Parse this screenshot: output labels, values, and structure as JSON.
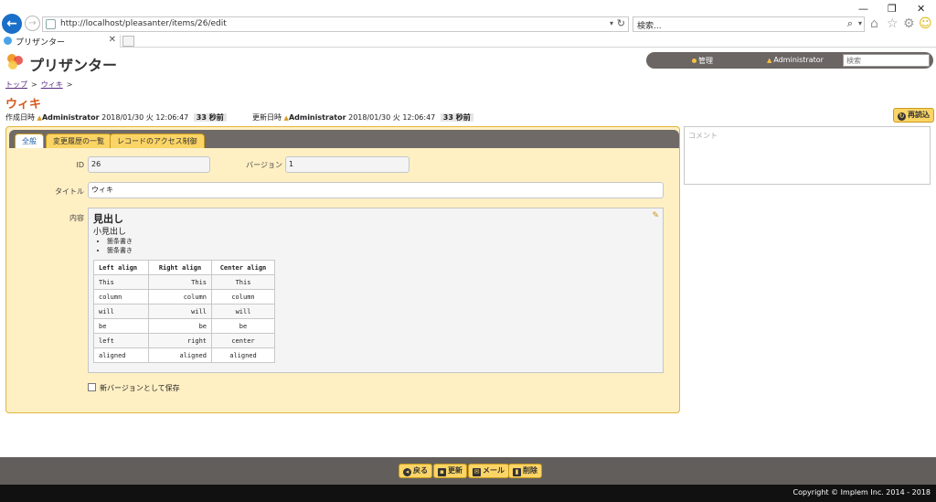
{
  "browser": {
    "url": "http://localhost/pleasanter/items/26/edit",
    "search_placeholder": "検索...",
    "tab_title": "プリザンター"
  },
  "app": {
    "logo_text": "プリザンター",
    "header": {
      "admin_link": "管理",
      "user": "Administrator",
      "search_placeholder": "検索"
    }
  },
  "breadcrumb": [
    "トップ",
    "ウィキ"
  ],
  "page_title": "ウィキ",
  "meta": {
    "created_label": "作成日時",
    "created_user": "Administrator",
    "created_time": "2018/01/30 火 12:06:47",
    "created_ago": "33 秒前",
    "updated_label": "更新日時",
    "updated_user": "Administrator",
    "updated_time": "2018/01/30 火 12:06:47",
    "updated_ago": "33 秒前"
  },
  "reload_button": "再読込",
  "comment_placeholder": "コメント",
  "tabs": [
    "全般",
    "変更履歴の一覧",
    "レコードのアクセス制御"
  ],
  "form": {
    "id_label": "ID",
    "id_value": "26",
    "version_label": "バージョン",
    "version_value": "1",
    "title_label": "タイトル",
    "title_value": "ウィキ",
    "content_label": "内容",
    "save_new_version": "新バージョンとして保存"
  },
  "content": {
    "h1": "見出し",
    "h2": "小見出し",
    "bullets": [
      "箇条書き",
      "箇条書き"
    ],
    "table": {
      "headers": [
        "Left align",
        "Right align",
        "Center align"
      ],
      "rows": [
        [
          "This",
          "This",
          "This"
        ],
        [
          "column",
          "column",
          "column"
        ],
        [
          "will",
          "will",
          "will"
        ],
        [
          "be",
          "be",
          "be"
        ],
        [
          "left",
          "right",
          "center"
        ],
        [
          "aligned",
          "aligned",
          "aligned"
        ]
      ]
    }
  },
  "footer_buttons": {
    "back": "戻る",
    "update": "更新",
    "mail": "メール",
    "delete": "削除"
  },
  "copyright": "Copyright © Implem Inc. 2014 - 2018",
  "colors": {
    "accent": "#fbd466",
    "title": "#d25a1e",
    "panel": "#fff0c4",
    "header_bar": "#6b6563"
  }
}
